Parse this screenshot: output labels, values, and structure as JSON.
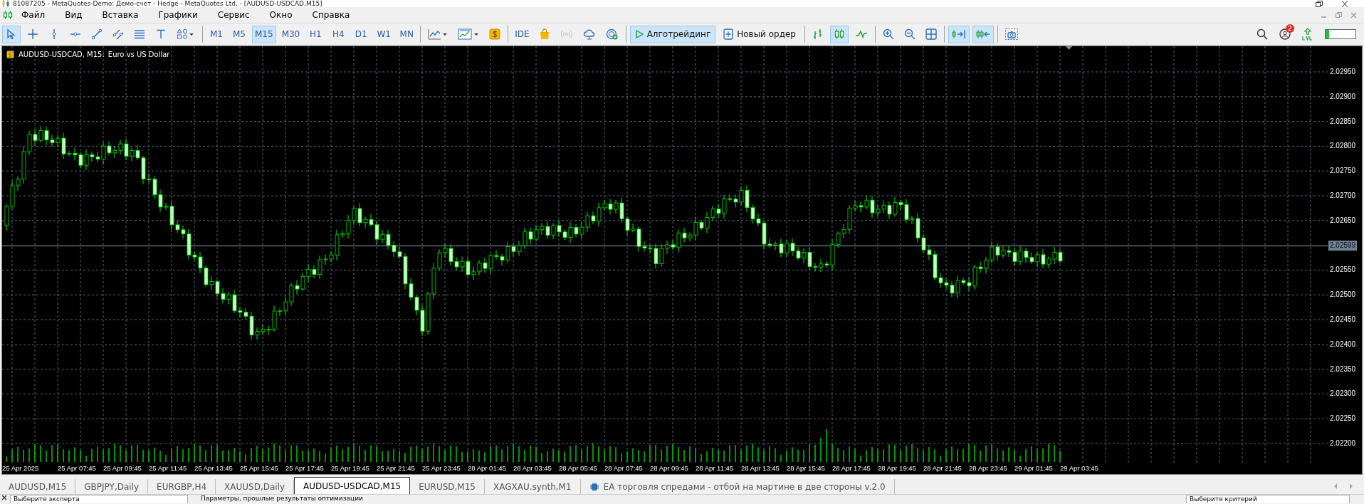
{
  "window": {
    "title": "81087205 - MetaQuotes-Demo: Демо-счет - Hedge - MetaQuotes Ltd. - [AUDUSD-USDCAD,M15]"
  },
  "menu": [
    "Файл",
    "Вид",
    "Вставка",
    "Графики",
    "Сервис",
    "Окно",
    "Справка"
  ],
  "toolbar": {
    "groups": [
      {
        "items": [
          {
            "kind": "cursor",
            "selected": true
          },
          {
            "kind": "crosshair",
            "selected": false
          },
          {
            "kind": "vline",
            "selected": false
          },
          {
            "kind": "hline",
            "selected": false
          },
          {
            "kind": "trend",
            "selected": false
          },
          {
            "kind": "channel",
            "selected": false
          },
          {
            "kind": "fibo",
            "selected": false
          },
          {
            "kind": "text",
            "selected": false
          },
          {
            "kind": "shapes",
            "selected": false
          }
        ]
      },
      {
        "items": [
          {
            "kind": "timeframe",
            "label": "M1",
            "selected": false
          },
          {
            "kind": "timeframe",
            "label": "M5",
            "selected": false
          },
          {
            "kind": "timeframe",
            "label": "M15",
            "selected": true
          },
          {
            "kind": "timeframe",
            "label": "M30",
            "selected": false
          },
          {
            "kind": "timeframe",
            "label": "H1",
            "selected": false
          },
          {
            "kind": "timeframe",
            "label": "H4",
            "selected": false
          },
          {
            "kind": "timeframe",
            "label": "D1",
            "selected": false
          },
          {
            "kind": "timeframe",
            "label": "W1",
            "selected": false
          },
          {
            "kind": "timeframe",
            "label": "MN",
            "selected": false
          }
        ]
      },
      {
        "items": [
          {
            "kind": "charttype",
            "selected": false
          },
          {
            "kind": "template",
            "selected": false
          },
          {
            "kind": "dollar",
            "selected": false
          }
        ]
      },
      {
        "items": [
          {
            "kind": "ide",
            "label": "IDE",
            "selected": false
          },
          {
            "kind": "market",
            "selected": false
          },
          {
            "kind": "signals",
            "selected": false,
            "disabled": true
          },
          {
            "kind": "cloud",
            "selected": false
          },
          {
            "kind": "vps",
            "selected": false
          }
        ]
      },
      {
        "items": [
          {
            "kind": "algo",
            "label": "Алготрейдинг",
            "selected": true
          },
          {
            "kind": "order",
            "label": "Новый ордер",
            "selected": false
          }
        ]
      },
      {
        "items": [
          {
            "kind": "bars",
            "selected": false
          },
          {
            "kind": "candles",
            "selected": true
          },
          {
            "kind": "line",
            "selected": false
          }
        ]
      },
      {
        "items": [
          {
            "kind": "zoomin",
            "selected": false
          },
          {
            "kind": "zoomout",
            "selected": false
          },
          {
            "kind": "grid",
            "selected": false
          }
        ]
      },
      {
        "items": [
          {
            "kind": "autoscroll",
            "selected": true
          },
          {
            "kind": "shift",
            "selected": true
          }
        ]
      },
      {
        "items": [
          {
            "kind": "screenshot",
            "selected": false
          }
        ]
      }
    ],
    "notifications_badge": "2",
    "level_meter": {
      "level": 0.12
    }
  },
  "chart": {
    "symbol": "AUDUSD-USDCAD, M15:",
    "description": "Euro vs US Dollar",
    "price_labels": [
      "2.02950",
      "2.02900",
      "2.02850",
      "2.02800",
      "2.02750",
      "2.02700",
      "2.02650",
      "2.02550",
      "2.02500",
      "2.02450",
      "2.02400",
      "2.02350",
      "2.02300",
      "2.02250",
      "2.02200"
    ],
    "current_price": "2.02599",
    "time_labels": [
      "25 Apr 2025",
      "25 Apr 07:45",
      "25 Apr 09:45",
      "25 Apr 11:45",
      "25 Apr 13:45",
      "25 Apr 15:45",
      "25 Apr 17:45",
      "25 Apr 19:45",
      "25 Apr 21:45",
      "25 Apr 23:45",
      "28 Apr 01:45",
      "28 Apr 03:45",
      "28 Apr 05:45",
      "28 Apr 07:45",
      "28 Apr 09:45",
      "28 Apr 11:45",
      "28 Apr 13:45",
      "28 Apr 15:45",
      "28 Apr 17:45",
      "28 Apr 19:45",
      "28 Apr 21:45",
      "28 Apr 23:45",
      "29 Apr 01:45",
      "29 Apr 03:45"
    ]
  },
  "tabs": [
    {
      "kind": "chart",
      "label": "AUDUSD,M15",
      "selected": false
    },
    {
      "kind": "chart",
      "label": "GBPJPY,Daily",
      "selected": false
    },
    {
      "kind": "chart",
      "label": "EURGBP,H4",
      "selected": false
    },
    {
      "kind": "chart",
      "label": "XAUUSD,Daily",
      "selected": false
    },
    {
      "kind": "chart",
      "label": "AUDUSD-USDCAD,M15",
      "selected": true
    },
    {
      "kind": "chart",
      "label": "EURUSD,M15",
      "selected": false
    },
    {
      "kind": "chart",
      "label": "XAGXAU.synth,M1",
      "selected": false
    },
    {
      "kind": "expert",
      "label": "EA торговля спредами - отбой на мартине в две стороны v.2.0",
      "selected": false
    }
  ],
  "tester": {
    "expert_field": "Выберите эксперта",
    "description": "Параметры, прошлые результаты оптимизации",
    "criterion_field": "Выберите критерий"
  }
}
